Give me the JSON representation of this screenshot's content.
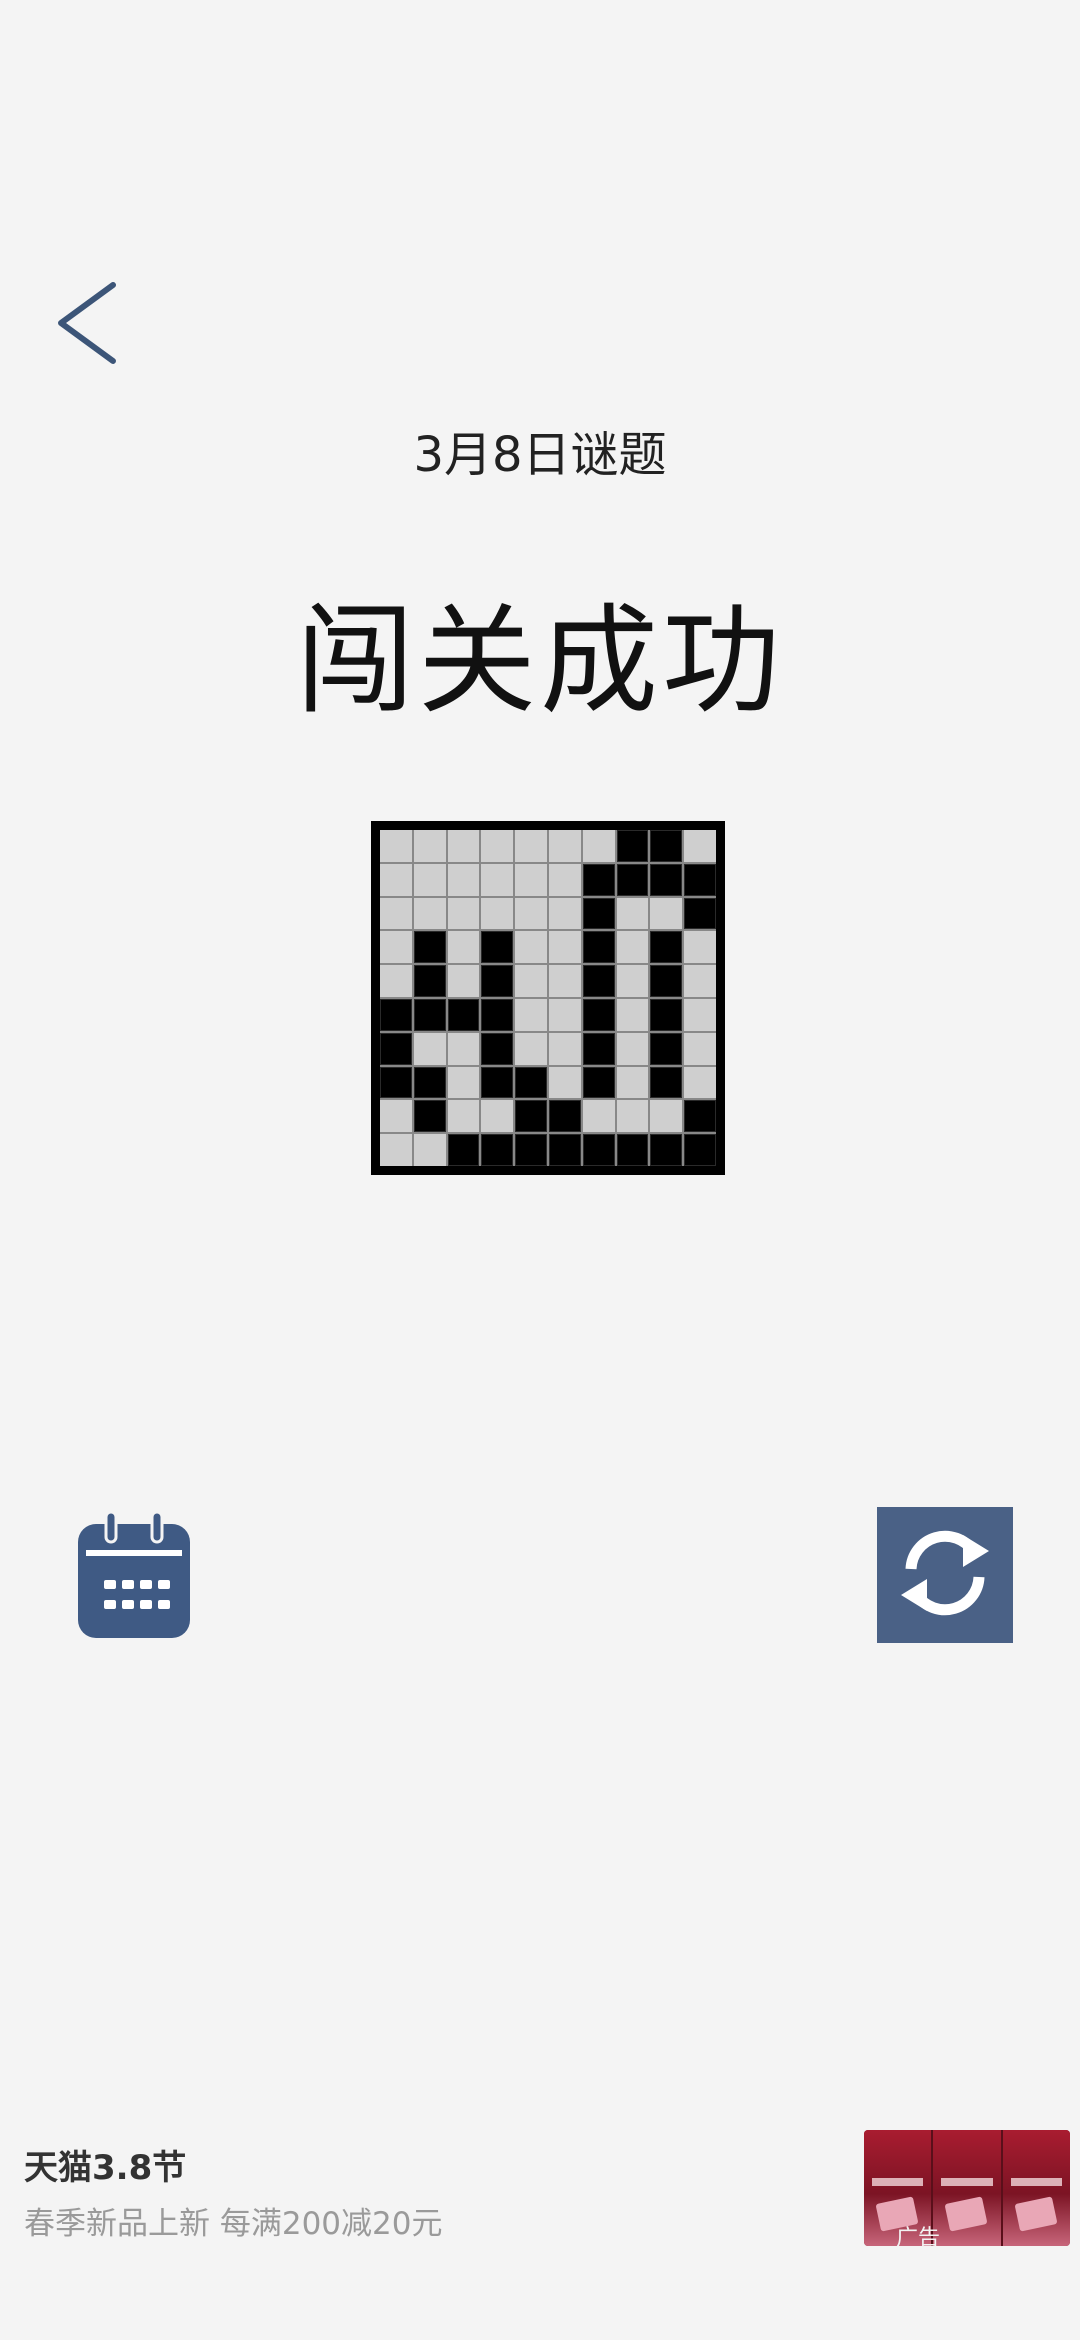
{
  "header": {
    "back_icon": "chevron-left-icon",
    "subtitle": "3月8日谜题",
    "title": "闯关成功"
  },
  "puzzle": {
    "rows": [
      "0000000110",
      "0000001111",
      "0000001001",
      "0101001010",
      "0101001010",
      "1111001010",
      "1001001010",
      "1101101010",
      "0100110001",
      "0011111111"
    ],
    "filled_color": "#000000",
    "empty_color": "#cfcfcf"
  },
  "actions": {
    "calendar_icon": "calendar-icon",
    "refresh_icon": "refresh-icon",
    "accent_color": "#3f5a84"
  },
  "ad": {
    "title": "天猫3.8节",
    "description": "春季新品上新 每满200减20元",
    "tag": "广告"
  }
}
